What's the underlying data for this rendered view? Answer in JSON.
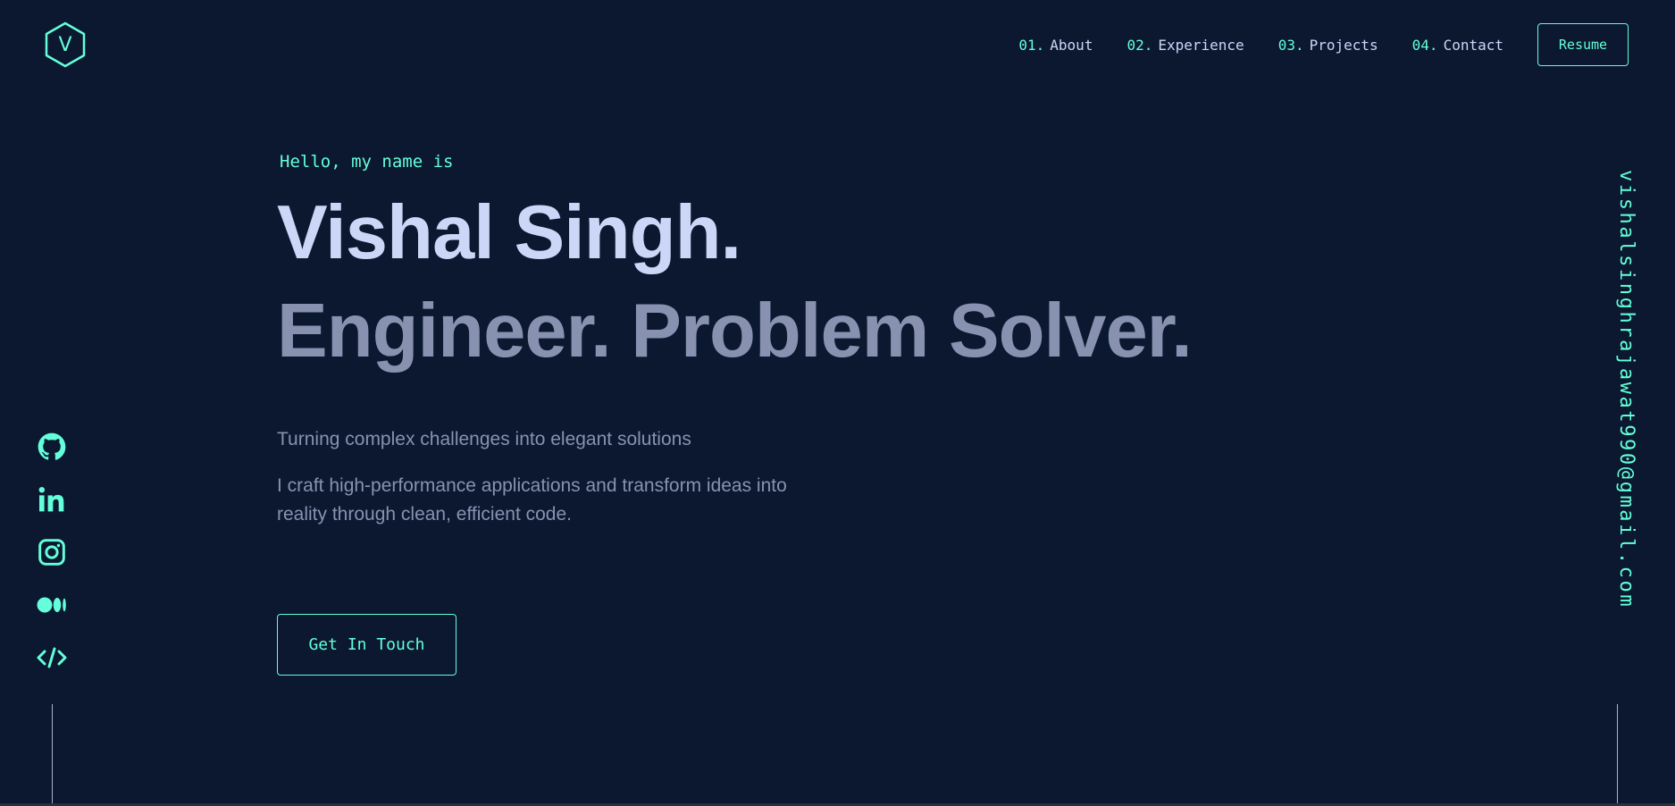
{
  "logo": {
    "letter": "V",
    "icon": "hexagon-logo-icon"
  },
  "nav": {
    "items": [
      {
        "num": "01.",
        "label": "About"
      },
      {
        "num": "02.",
        "label": "Experience"
      },
      {
        "num": "03.",
        "label": "Projects"
      },
      {
        "num": "04.",
        "label": "Contact"
      }
    ],
    "resume_label": "Resume"
  },
  "hero": {
    "greeting": "Hello, my name is",
    "name": "Vishal Singh.",
    "tagline": "Engineer. Problem Solver.",
    "subtitle": "Turning complex challenges into elegant solutions",
    "description": "I craft high-performance applications and transform ideas into reality through clean, efficient code.",
    "cta_label": "Get In Touch"
  },
  "social": [
    "github-icon",
    "linkedin-icon",
    "instagram-icon",
    "medium-icon",
    "code-icon"
  ],
  "email": "vishalsinghrajawat990@gmail.com",
  "colors": {
    "background": "#0b1830",
    "accent": "#64ffda",
    "heading": "#ccd6f6",
    "text": "#8892b0"
  }
}
